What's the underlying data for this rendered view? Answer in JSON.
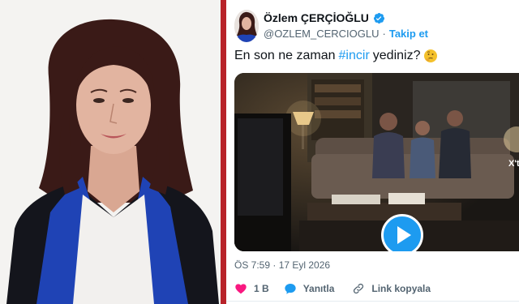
{
  "tweet": {
    "display_name": "Özlem ÇERÇİOĞLU",
    "handle": "@OZLEM_CERCIOGLU",
    "separator": "·",
    "follow_label": "Takip et",
    "text_prefix": "En son ne zaman",
    "hashtag": "#incir",
    "text_suffix": "yediniz?",
    "video_badge": "X'te",
    "timestamp": "ÖS 7:59 · 17 Eyl 2026",
    "actions": {
      "like_count": "1 B",
      "reply_label": "Yanıtla",
      "copy_link_label": "Link kopyala"
    }
  },
  "colors": {
    "accent": "#1d9bf0",
    "like": "#f91880",
    "divider": "#b8232a",
    "muted_text": "#536471"
  },
  "icons": [
    "verified-badge-icon",
    "thinking-face-emoji",
    "play-icon",
    "heart-icon",
    "reply-bubble-icon",
    "link-icon"
  ]
}
